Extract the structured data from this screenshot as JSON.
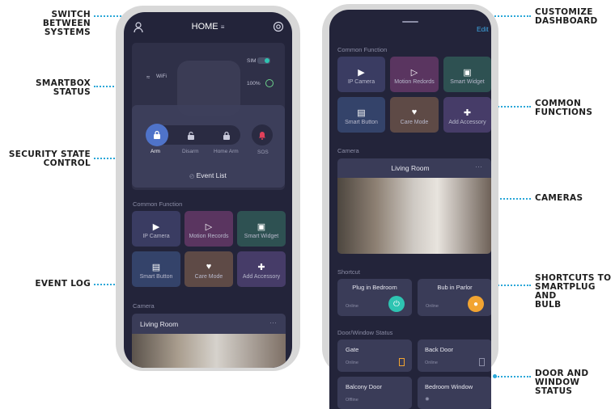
{
  "annotations": {
    "switch_systems": [
      "SWITCH BETWEEN",
      "SYSTEMS"
    ],
    "smartbox_status": [
      "SMARTBOX",
      "STATUS"
    ],
    "security_state": [
      "SECURITY STATE",
      "CONTROL"
    ],
    "event_log": [
      "EVENT LOG"
    ],
    "customize_dashboard": [
      "CUSTOMIZE",
      "DASHBOARD"
    ],
    "common_functions": [
      "COMMON",
      "FUNCTIONS"
    ],
    "cameras": [
      "CAMERAS"
    ],
    "shortcuts": [
      "SHORTCUTS TO",
      "SMARTPLUG AND",
      "BULB"
    ],
    "door_window": [
      "DOOR AND",
      "WINDOW STATUS"
    ]
  },
  "left_phone": {
    "header_title": "HOME",
    "smartbox": {
      "wifi": "WiFi",
      "sim": "SIM",
      "battery": "100%"
    },
    "security": {
      "arm": "Arm",
      "disarm": "Disarm",
      "home_arm": "Home Arm",
      "sos": "SOS"
    },
    "event_list": "Event List",
    "common_function_title": "Common Function",
    "functions": [
      "IP Camera",
      "Motion Records",
      "Smart Widget",
      "Smart Button",
      "Care Mode",
      "Add Accessory"
    ],
    "camera_title": "Camera",
    "camera_name": "Living Room",
    "more": "···"
  },
  "right_phone": {
    "edit": "Edit",
    "common_function_title": "Common Function",
    "functions": [
      "IP Camera",
      "Motion Redords",
      "Smart Widget",
      "Smart Button",
      "Care Mode",
      "Add Accessory"
    ],
    "camera_title": "Camera",
    "camera_name": "Living Room",
    "more": "···",
    "shortcut_title": "Shortcut",
    "shortcuts": [
      {
        "name": "Plug in Bedroom",
        "status": "Online"
      },
      {
        "name": "Bub in Parlor",
        "status": "Online"
      }
    ],
    "door_title": "Door/Window Status",
    "doors": [
      {
        "name": "Gate",
        "status": "Online"
      },
      {
        "name": "Back Door",
        "status": "Online"
      },
      {
        "name": "Balcony Door",
        "status": "Offline"
      },
      {
        "name": "Bedroom Window",
        "status": ""
      }
    ]
  },
  "colors": {
    "callout_line": "#2aa7d8",
    "screen_bg": "#23243a",
    "arm_active": "#4f73c9",
    "sos": "#e0405a",
    "plug_icon": "#2ec4b2",
    "bulb_icon": "#f2a431"
  }
}
